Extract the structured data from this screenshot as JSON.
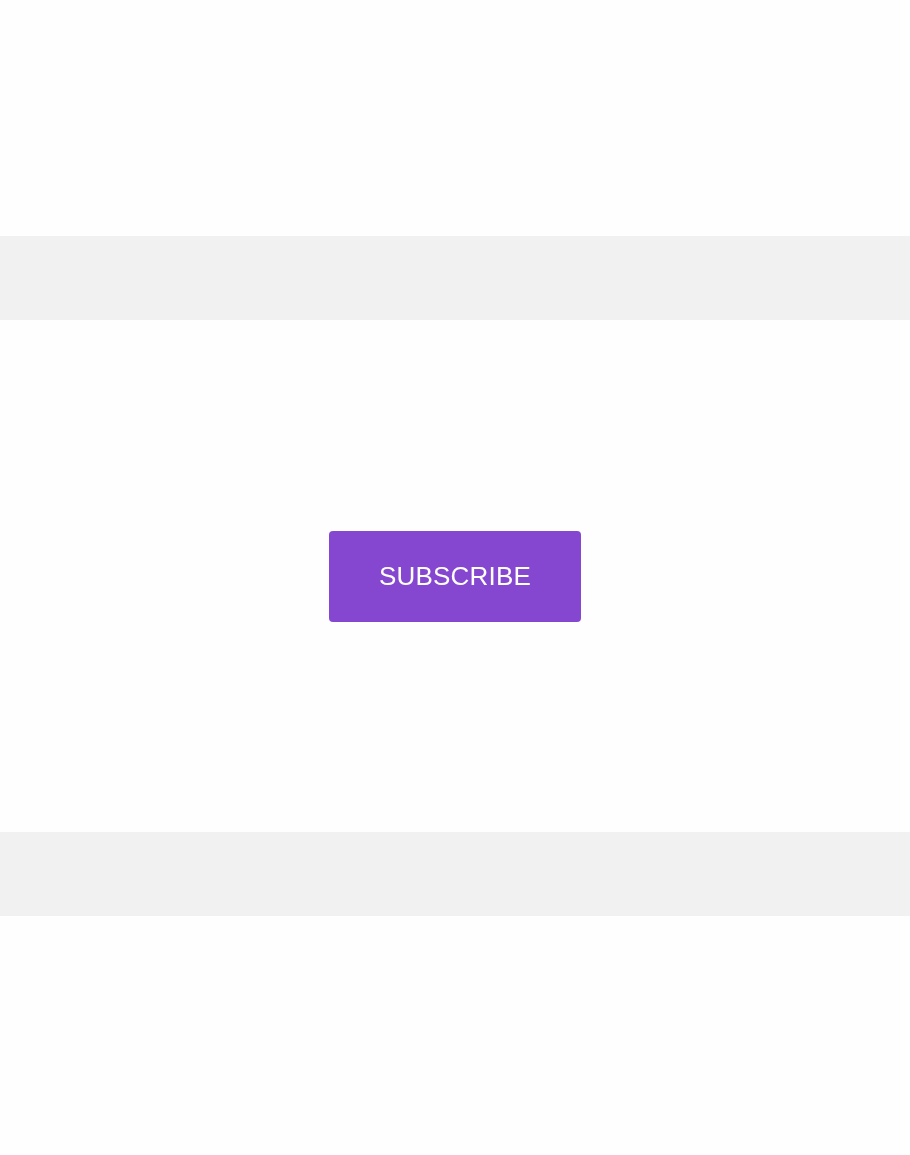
{
  "button": {
    "label": "SUBSCRIBE"
  }
}
